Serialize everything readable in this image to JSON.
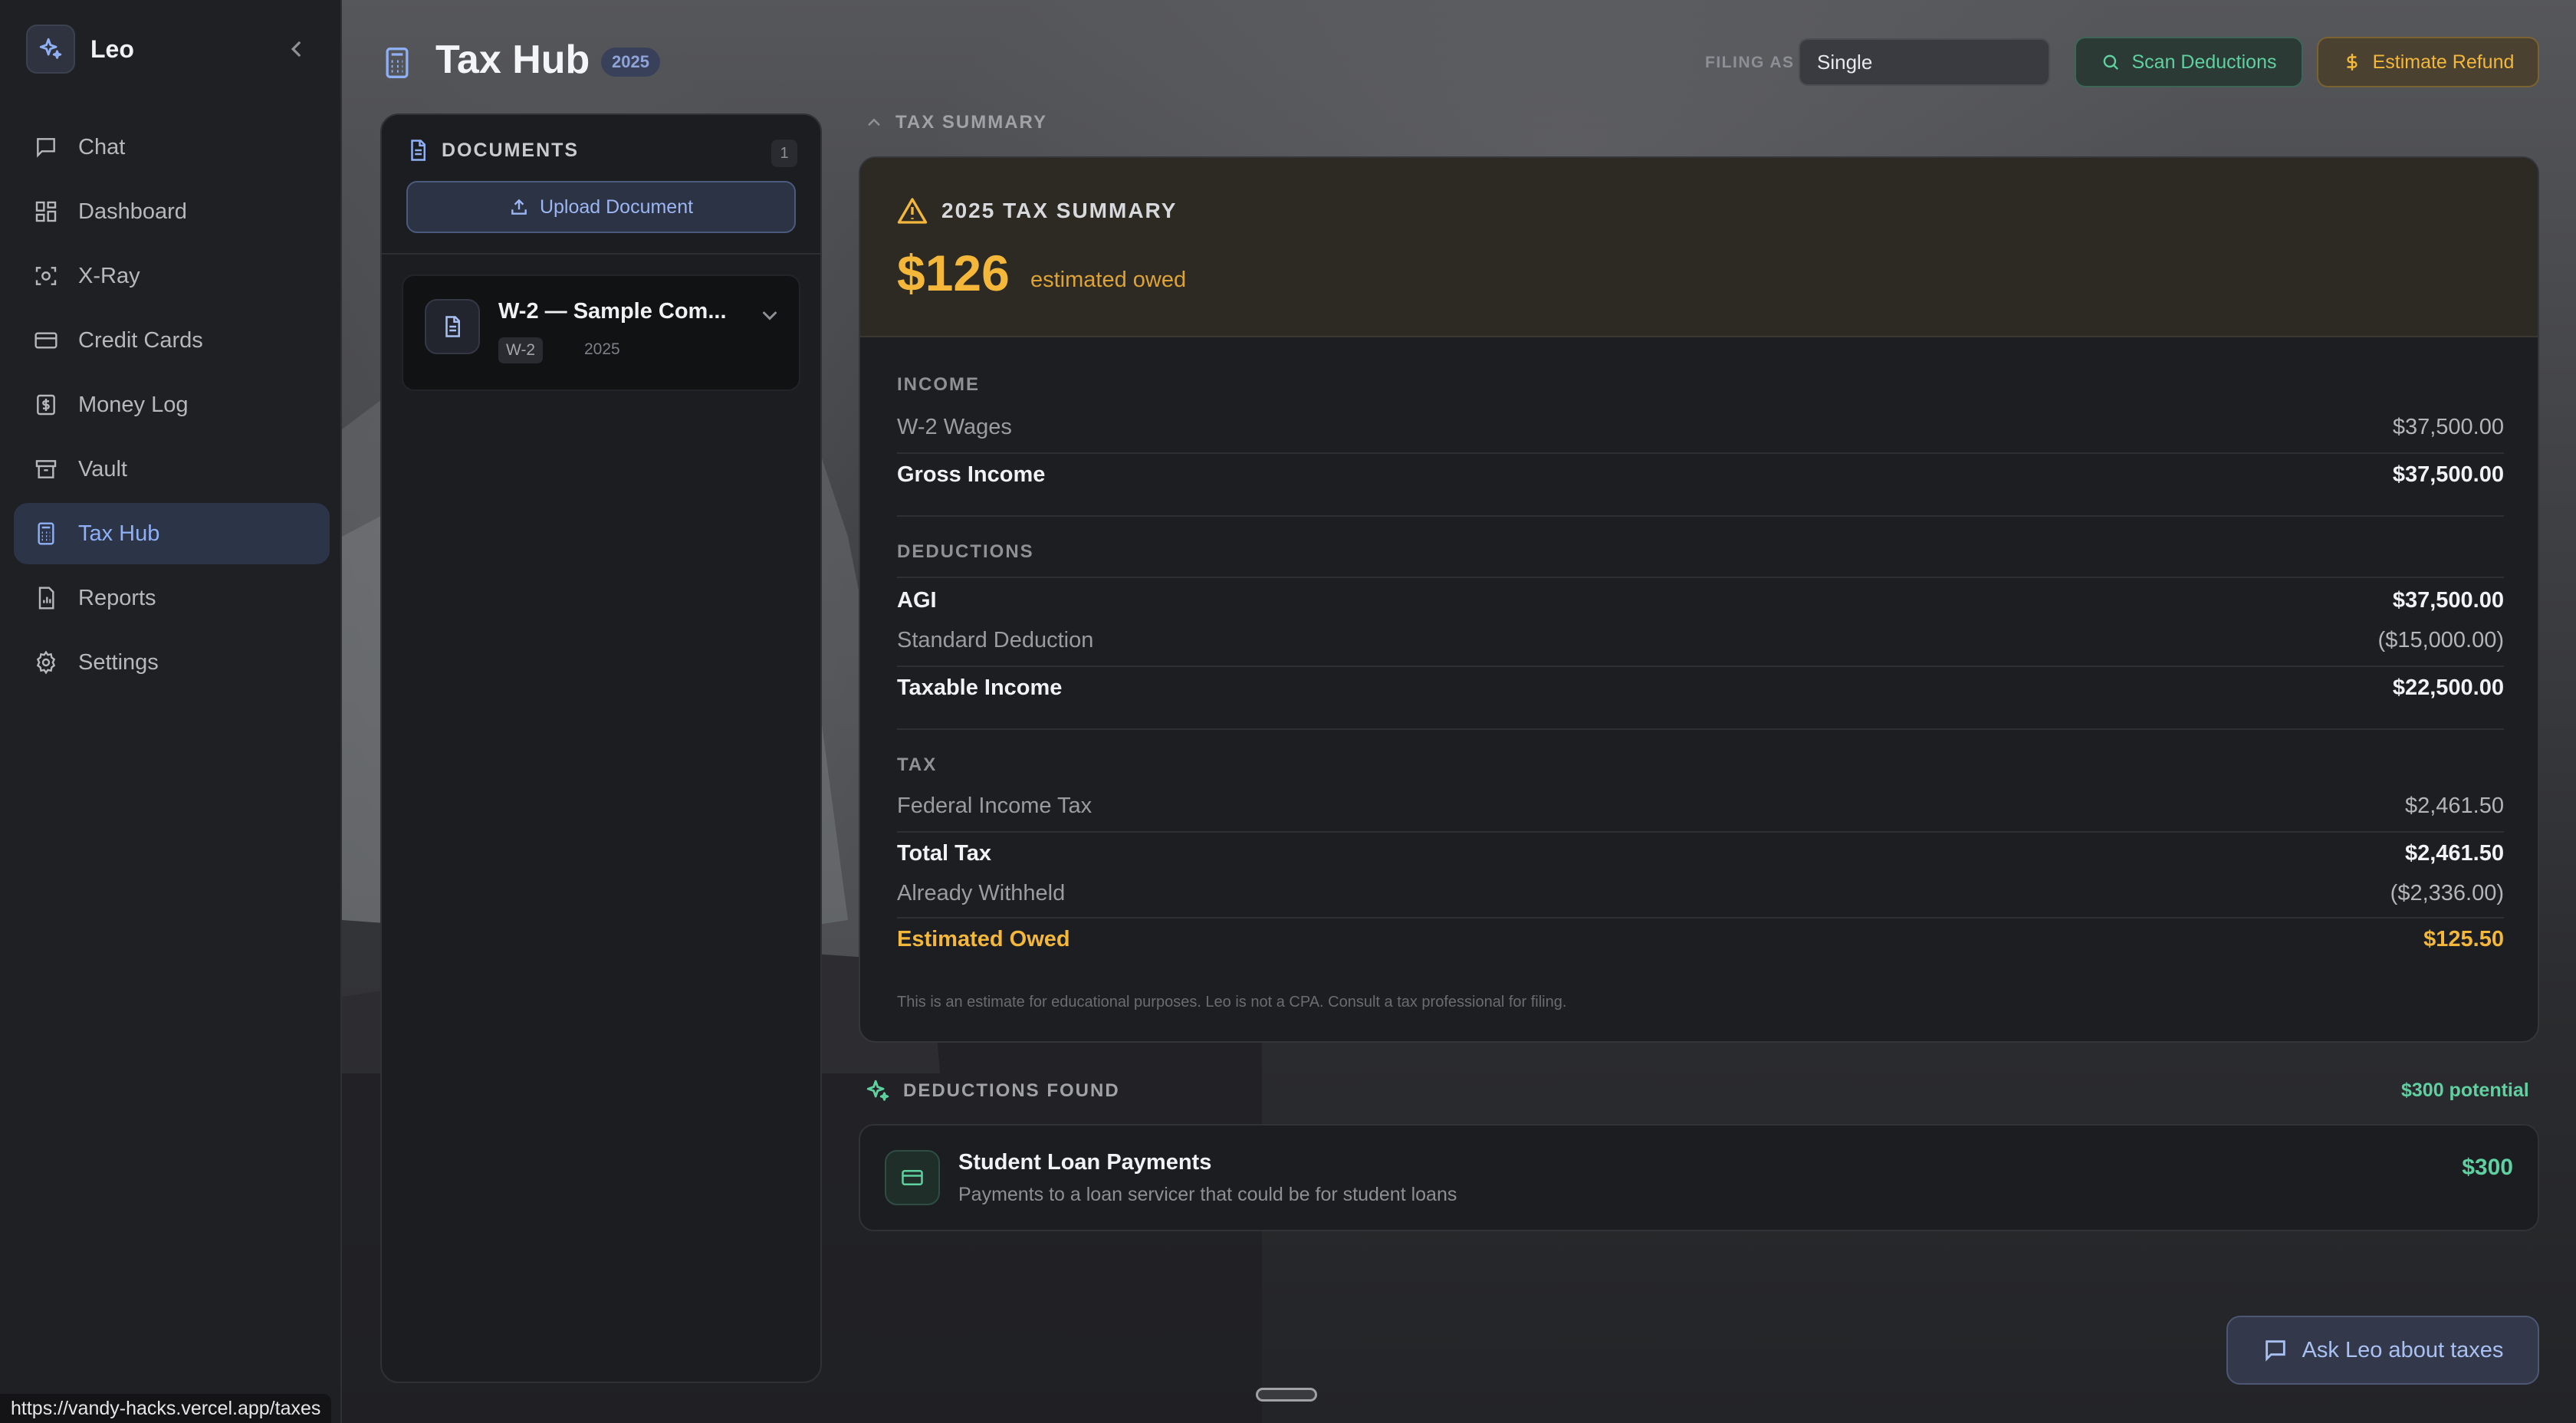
{
  "sidebar": {
    "brand": "Leo",
    "items": [
      {
        "label": "Chat",
        "icon": "chat-icon"
      },
      {
        "label": "Dashboard",
        "icon": "dashboard-icon"
      },
      {
        "label": "X-Ray",
        "icon": "xray-icon"
      },
      {
        "label": "Credit Cards",
        "icon": "credit-card-icon"
      },
      {
        "label": "Money Log",
        "icon": "money-log-icon"
      },
      {
        "label": "Vault",
        "icon": "vault-icon"
      },
      {
        "label": "Tax Hub",
        "icon": "calculator-icon",
        "active": true
      },
      {
        "label": "Reports",
        "icon": "reports-icon"
      },
      {
        "label": "Settings",
        "icon": "gear-icon"
      }
    ]
  },
  "status_url": "https://vandy-hacks.vercel.app/taxes",
  "header": {
    "title": "Tax Hub",
    "year": "2025",
    "filing_label": "FILING AS",
    "filing_value": "Single",
    "scan_label": "Scan Deductions",
    "refund_label": "Estimate Refund"
  },
  "documents": {
    "title": "DOCUMENTS",
    "count": "1",
    "upload_label": "Upload Document",
    "items": [
      {
        "name": "W-2 — Sample Com...",
        "tag": "W-2",
        "year": "2025"
      }
    ]
  },
  "summary": {
    "section_label": "TAX SUMMARY",
    "title": "2025 TAX SUMMARY",
    "amount": "$126",
    "amount_caption": "estimated owed",
    "income_label": "INCOME",
    "deductions_label": "DEDUCTIONS",
    "tax_label": "TAX",
    "rows": {
      "w2_wages": {
        "label": "W-2 Wages",
        "value": "$37,500.00"
      },
      "gross_income": {
        "label": "Gross Income",
        "value": "$37,500.00"
      },
      "agi": {
        "label": "AGI",
        "value": "$37,500.00"
      },
      "standard_deduction": {
        "label": "Standard Deduction",
        "value": "($15,000.00)"
      },
      "taxable_income": {
        "label": "Taxable Income",
        "value": "$22,500.00"
      },
      "federal_tax": {
        "label": "Federal Income Tax",
        "value": "$2,461.50"
      },
      "total_tax": {
        "label": "Total Tax",
        "value": "$2,461.50"
      },
      "withheld": {
        "label": "Already Withheld",
        "value": "($2,336.00)"
      },
      "estimated_owed": {
        "label": "Estimated Owed",
        "value": "$125.50"
      }
    },
    "disclaimer": "This is an estimate for educational purposes. Leo is not a CPA. Consult a tax professional for filing."
  },
  "deductions": {
    "title": "DEDUCTIONS FOUND",
    "potential": "$300 potential",
    "items": [
      {
        "name": "Student Loan Payments",
        "description": "Payments to a loan servicer that could be for student loans",
        "amount": "$300"
      }
    ]
  },
  "ask_label": "Ask Leo about taxes",
  "colors": {
    "accent_blue": "#8fb0f5",
    "accent_green": "#5fd0a0",
    "accent_amber": "#f3b73b"
  }
}
